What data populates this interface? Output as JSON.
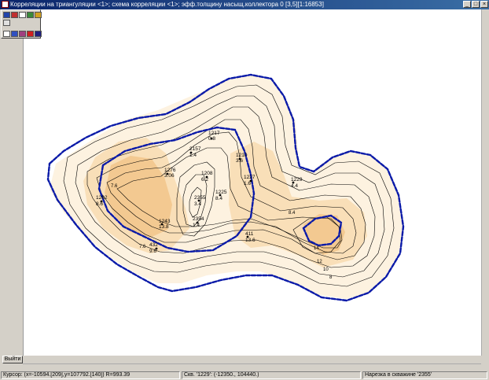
{
  "window": {
    "title": "Корреляции на триангуляции <1>; схема корреляции <1>; эфф.толщину насыщ.коллектора 0 [3,5][1:16853]"
  },
  "title_buttons": [
    "_",
    "□",
    "×"
  ],
  "tools": [
    "tool-a",
    "tool-b",
    "tool-c",
    "tool-d",
    "tool-e",
    "tool-f",
    "tool-g",
    "tool-h",
    "tool-i"
  ],
  "exit_button": "Выйти",
  "status": {
    "cursor": "Курсор: (x=-10594.[209],y=107792.[140]) R=993.39",
    "well": "Скв. '1229': (-12350., 104440.)",
    "cut": "Нарезка в скважине '2355'"
  },
  "map": {
    "wells": [
      {
        "id": "1217",
        "value": "0.8"
      },
      {
        "id": "2157",
        "value": "1.4"
      },
      {
        "id": "1210",
        "value": "3.6"
      },
      {
        "id": "1276",
        "value": "3.06"
      },
      {
        "id": "1208",
        "value": "6.2"
      },
      {
        "id": "1227",
        "value": "1.6"
      },
      {
        "id": "1229",
        "value": "4.4"
      },
      {
        "id": "2355",
        "value": "3.4"
      },
      {
        "id": "1225",
        "value": "8.4"
      },
      {
        "id": "2354",
        "value": "1.4"
      },
      {
        "id": "1243",
        "value": "13.8"
      },
      {
        "id": "1262",
        "value": "8.6"
      },
      {
        "id": "411",
        "value": "13.6"
      },
      {
        "id": "432",
        "value": "9.6"
      }
    ],
    "contour_labels": [
      "7.6",
      "8.4",
      "7.6",
      "14",
      "12",
      "10",
      "8"
    ],
    "colors": {
      "boundary": "#0a1aa8",
      "fill_light": "#fdf2e0",
      "fill_mid": "#f9dfb8",
      "fill_dark": "#f3c991",
      "contour": "#000000"
    }
  }
}
